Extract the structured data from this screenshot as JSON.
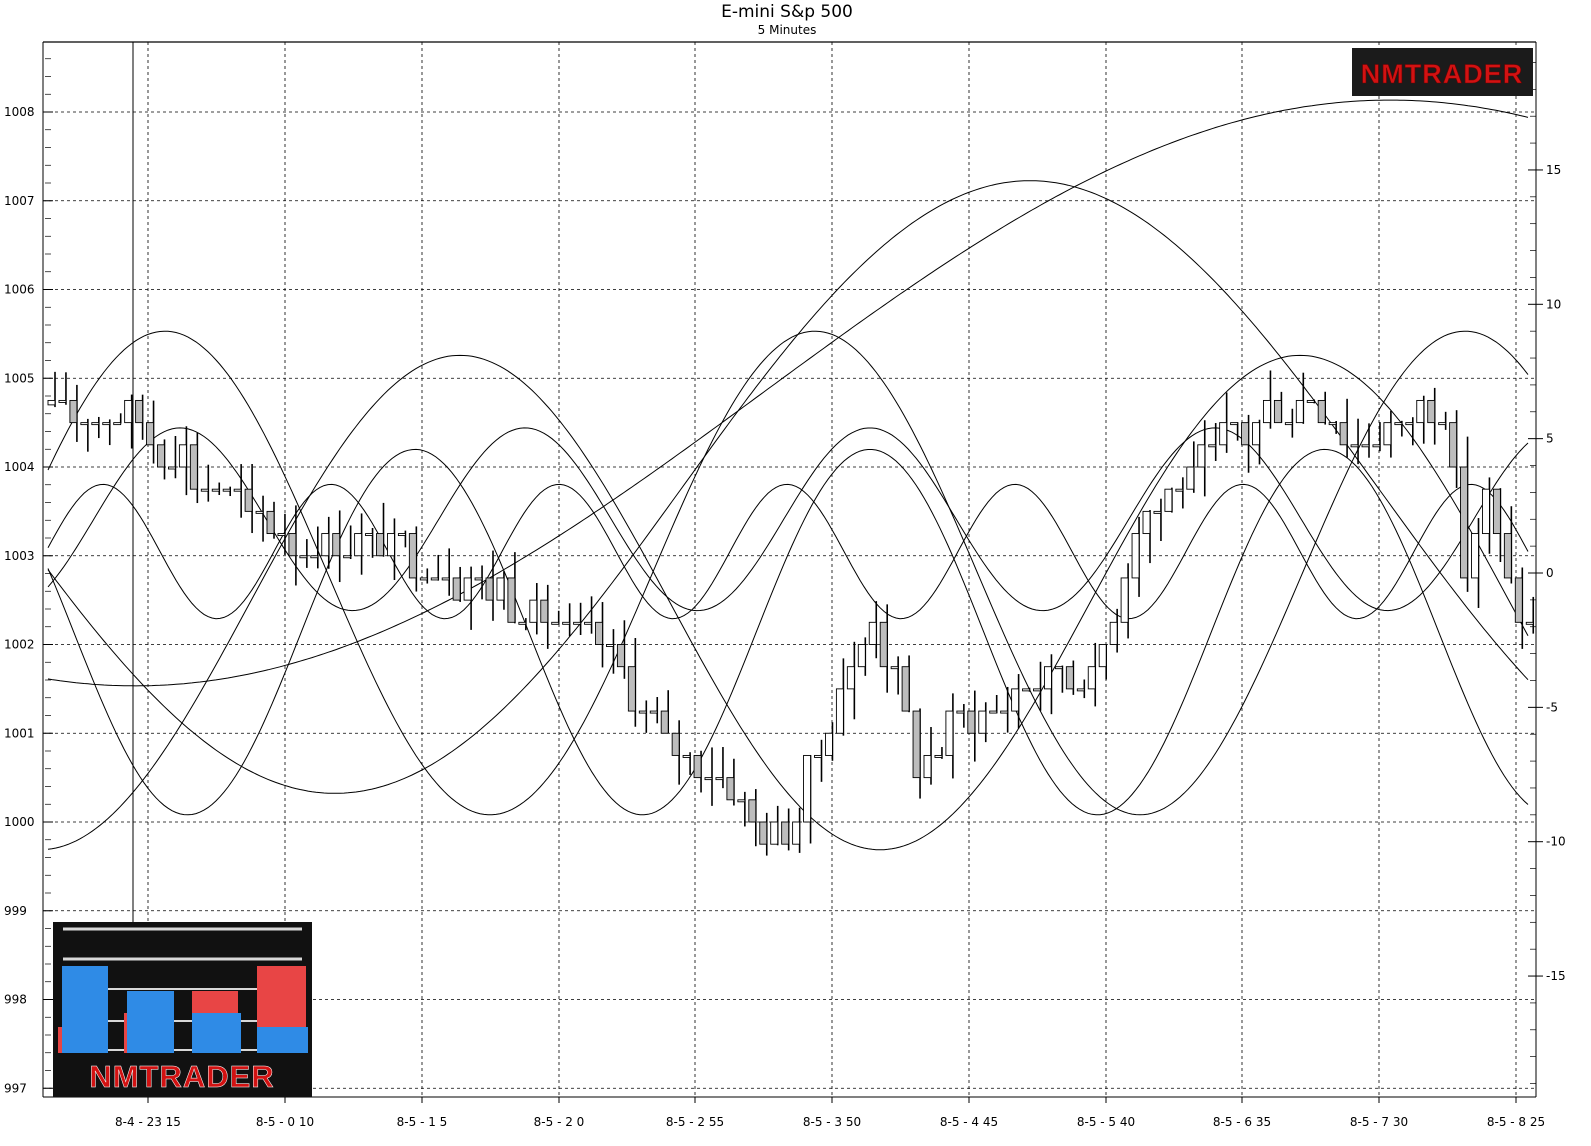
{
  "chart_data": {
    "type": "candlestick",
    "title": "E-mini S&p 500",
    "subtitle": "5 Minutes",
    "y_left": {
      "ticks": [
        1008,
        1007,
        1006,
        1005,
        1004,
        1003,
        1002,
        1001,
        1000,
        999,
        998,
        997
      ],
      "range": [
        996.8,
        1008.8
      ]
    },
    "y_right": {
      "ticks": [
        "15",
        "10",
        "5",
        "0",
        "-5",
        "-10",
        "-15"
      ],
      "values": [
        15,
        10,
        5,
        0,
        -5,
        -10,
        -15
      ],
      "range": [
        -20,
        20
      ]
    },
    "x_labels": [
      "8-4 - 23 15",
      "8-5 - 0 10",
      "8-5 - 1 5",
      "8-5 - 2 0",
      "8-5 - 2 55",
      "8-5 - 3 50",
      "8-5 - 4 45",
      "8-5 - 5 40",
      "8-5 - 6 35",
      "8-5 - 7 30",
      "8-5 - 8 25"
    ],
    "bars_count": 136,
    "close_path": [
      [
        0,
        1004.7
      ],
      [
        8,
        1004.6
      ],
      [
        12,
        1004.2
      ],
      [
        16,
        1003.7
      ],
      [
        22,
        1003.2
      ],
      [
        30,
        1003.2
      ],
      [
        36,
        1002.9
      ],
      [
        42,
        1002.6
      ],
      [
        48,
        1002.2
      ],
      [
        52,
        1001.8
      ],
      [
        56,
        1001.1
      ],
      [
        60,
        1000.6
      ],
      [
        64,
        1000.2
      ],
      [
        68,
        999.8
      ],
      [
        72,
        1001.2
      ],
      [
        76,
        1002.3
      ],
      [
        80,
        1000.6
      ],
      [
        84,
        1001.2
      ],
      [
        88,
        1001.4
      ],
      [
        92,
        1001.7
      ],
      [
        96,
        1001.6
      ],
      [
        100,
        1003.3
      ],
      [
        104,
        1003.8
      ],
      [
        108,
        1004.3
      ],
      [
        112,
        1004.6
      ],
      [
        116,
        1004.9
      ],
      [
        120,
        1004.3
      ],
      [
        124,
        1004.4
      ],
      [
        128,
        1004.8
      ],
      [
        130,
        1002.8
      ],
      [
        132,
        1003.6
      ],
      [
        135,
        1002.3
      ]
    ],
    "grid": true,
    "brand_text": "NMTRADER"
  },
  "colors": {
    "up_fill": "#ffffff",
    "down_fill": "#bdbdbd",
    "brand_red": "#cc1111",
    "logo_blue": "#2f8be6",
    "logo_red": "#e84545"
  },
  "logo_top_text": "NMTRADER",
  "logo_bottom_text": "NMTRADER"
}
